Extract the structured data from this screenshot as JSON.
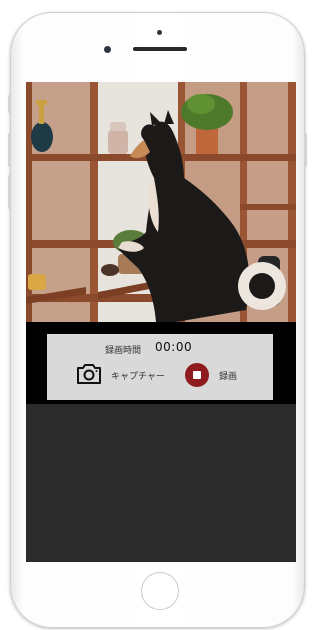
{
  "recording": {
    "time_label": "録画時間",
    "time_value": "00:00"
  },
  "controls": {
    "capture_label": "キャプチャー",
    "record_label": "録画"
  },
  "icons": {
    "capture": "camera-icon",
    "record": "stop-record-icon"
  },
  "colors": {
    "record_accent": "#8e1c1f",
    "panel": "#d9d9d9",
    "dark_area": "#2b2b2b"
  }
}
